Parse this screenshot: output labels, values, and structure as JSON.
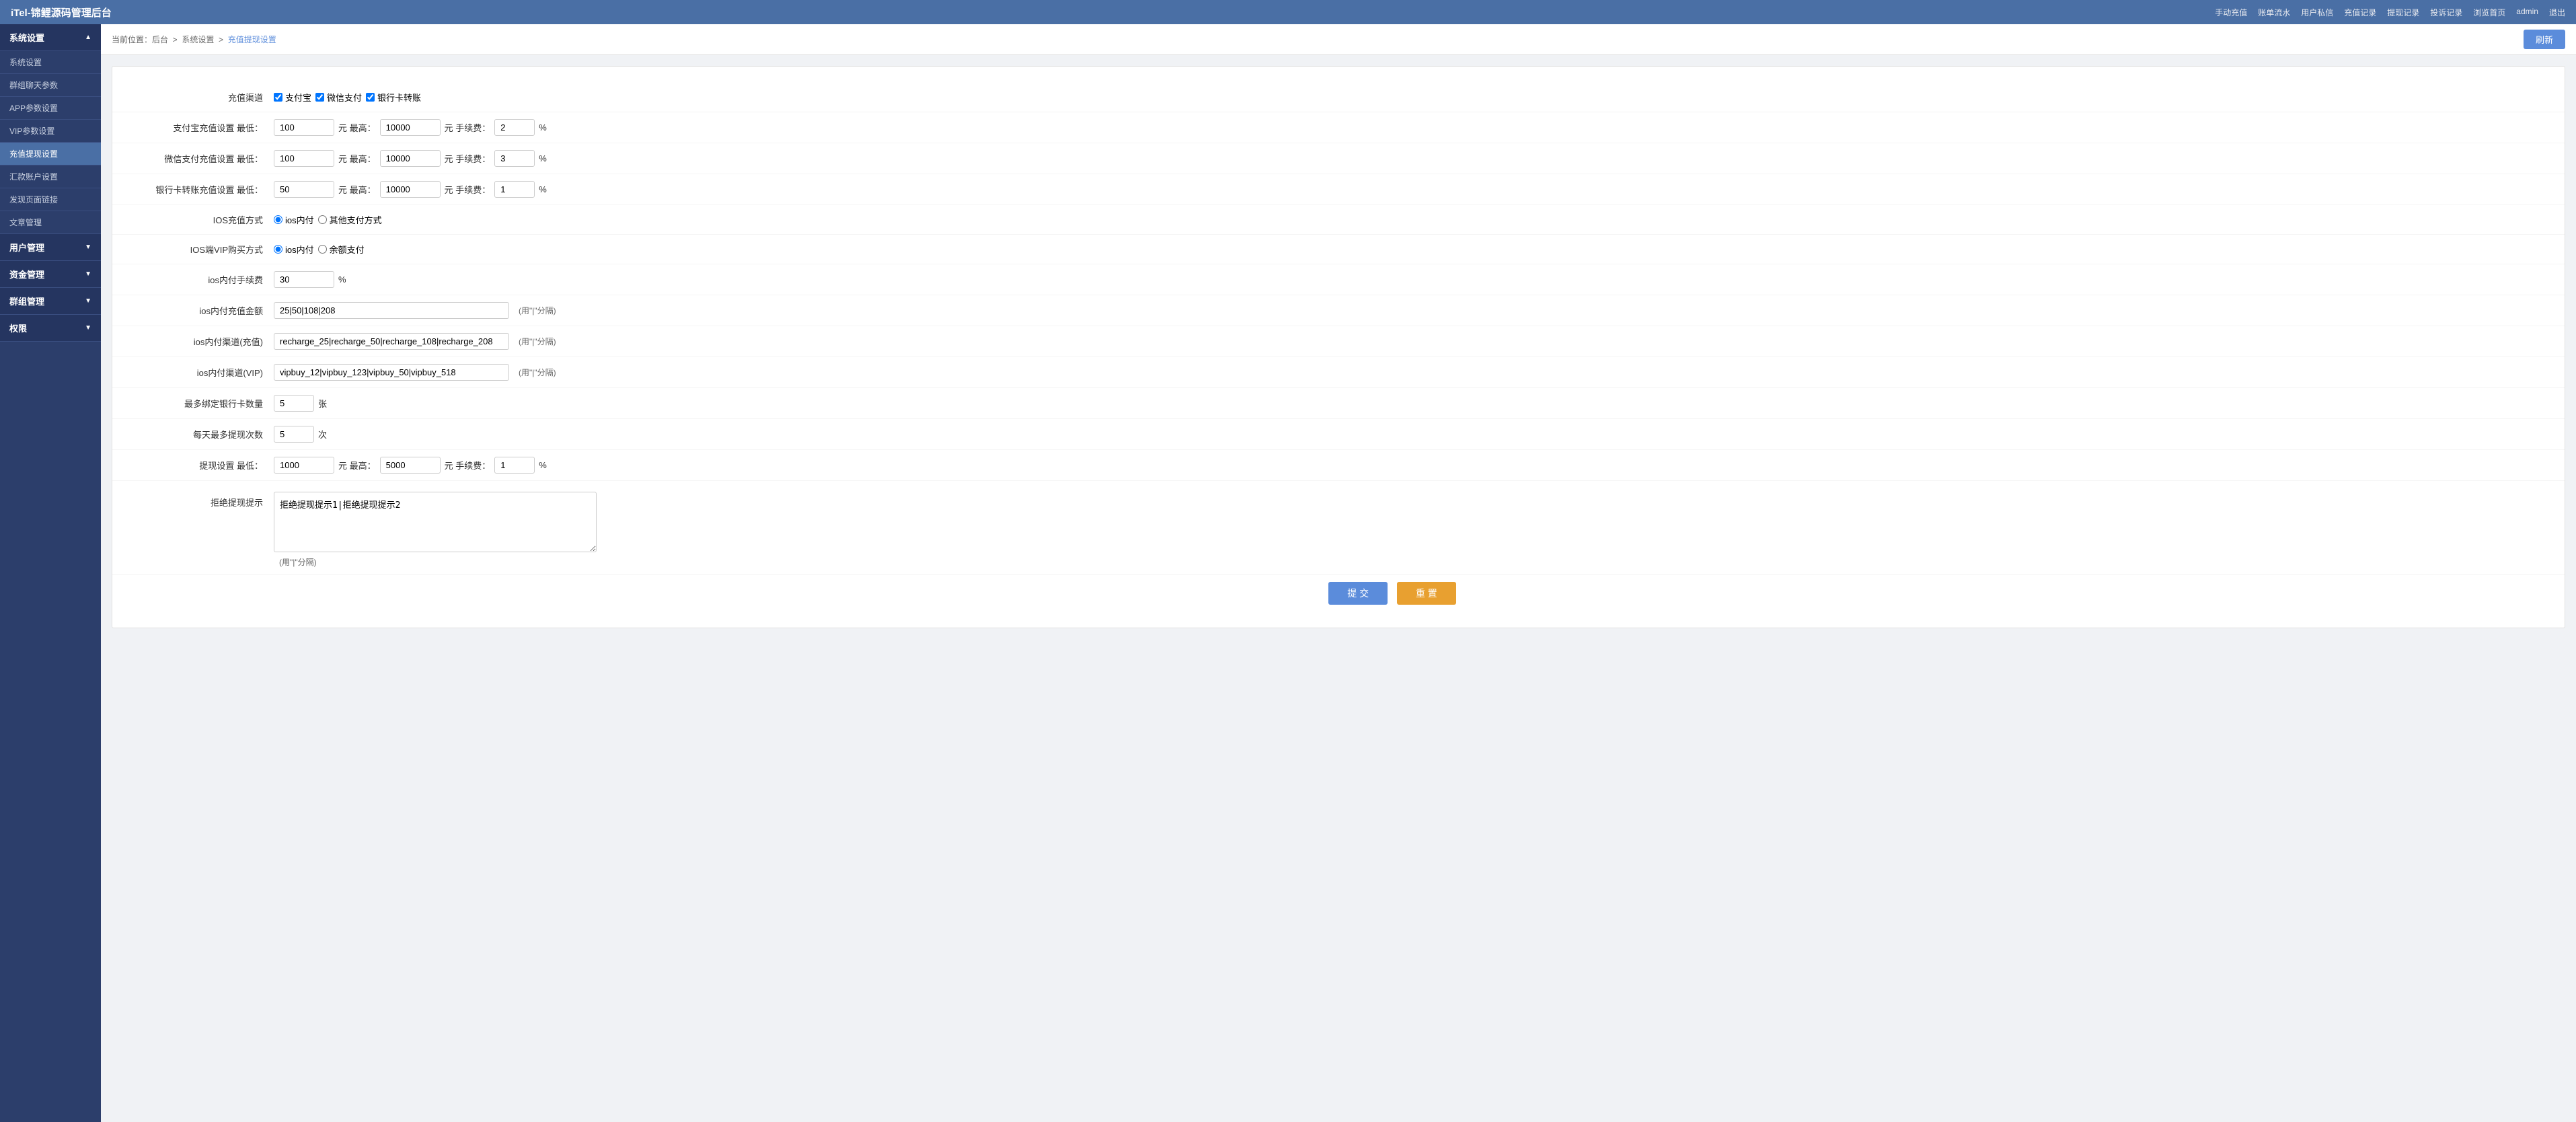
{
  "app": {
    "title": "iTel-锦鲤源码管理后台"
  },
  "topnav": {
    "links": [
      "手动充值",
      "账单流水",
      "用户私信",
      "充值记录",
      "提现记录",
      "投诉记录",
      "浏览首页",
      "admin",
      "退出"
    ]
  },
  "sidebar": {
    "sections": [
      {
        "label": "系统设置",
        "items": [
          {
            "label": "系统设置",
            "active": false
          },
          {
            "label": "群组聊天参数",
            "active": false
          },
          {
            "label": "APP参数设置",
            "active": false
          },
          {
            "label": "VIP参数设置",
            "active": false
          },
          {
            "label": "充值提现设置",
            "active": true
          },
          {
            "label": "汇款账户设置",
            "active": false
          },
          {
            "label": "发现页面链接",
            "active": false
          },
          {
            "label": "文章管理",
            "active": false
          }
        ]
      },
      {
        "label": "用户管理",
        "items": []
      },
      {
        "label": "资金管理",
        "items": []
      },
      {
        "label": "群组管理",
        "items": []
      },
      {
        "label": "权限",
        "items": []
      }
    ]
  },
  "breadcrumb": {
    "text": "当前位置：后台  >  系统设置  >  充值提现设置"
  },
  "refresh_label": "刷新",
  "form": {
    "recharge_channel_label": "充值渠道",
    "alipay_label": "支付宝",
    "wechat_label": "微信支付",
    "bank_label": "银行卡转账",
    "alipay_min_label": "支付宝充值设置 最低：",
    "alipay_min_val": "100",
    "alipay_max_label": "元 最高：",
    "alipay_max_val": "10000",
    "alipay_fee_label": "元 手续费：",
    "alipay_fee_val": "2",
    "alipay_fee_unit": "%",
    "wechat_min_label": "微信支付充值设置 最低：",
    "wechat_min_val": "100",
    "wechat_max_label": "元 最高：",
    "wechat_max_val": "10000",
    "wechat_fee_label": "元 手续费：",
    "wechat_fee_val": "3",
    "wechat_fee_unit": "%",
    "bank_min_label": "银行卡转账充值设置 最低：",
    "bank_min_val": "50",
    "bank_max_label": "元 最高：",
    "bank_max_val": "10000",
    "bank_fee_label": "元 手续费：",
    "bank_fee_val": "1",
    "bank_fee_unit": "%",
    "ios_pay_label": "IOS充值方式",
    "ios_pay_opt1": "ios内付",
    "ios_pay_opt2": "其他支付方式",
    "ios_vip_label": "IOS端VIP购买方式",
    "ios_vip_opt1": "ios内付",
    "ios_vip_opt2": "余额支付",
    "ios_fee_label": "ios内付手续费",
    "ios_fee_val": "30",
    "ios_fee_unit": "%",
    "ios_amount_label": "ios内付充值金额",
    "ios_amount_val": "25|50|108|208",
    "ios_amount_hint": "(用\"|\"分隔)",
    "ios_channel_label": "ios内付渠道(充值)",
    "ios_channel_val": "recharge_25|recharge_50|recharge_108|recharge_208",
    "ios_channel_hint": "(用\"|\"分隔)",
    "ios_vip_channel_label": "ios内付渠道(VIP)",
    "ios_vip_channel_val": "vipbuy_12|vipbuy_123|vipbuy_50|vipbuy_518",
    "ios_vip_channel_hint": "(用\"|\"分隔)",
    "max_bank_cards_label": "最多绑定银行卡数量",
    "max_bank_cards_val": "5",
    "max_bank_cards_unit": "张",
    "daily_withdraw_label": "每天最多提现次数",
    "daily_withdraw_val": "5",
    "daily_withdraw_unit": "次",
    "withdraw_min_label": "提现设置 最低：",
    "withdraw_min_val": "1000",
    "withdraw_max_label": "元 最高：",
    "withdraw_max_val": "5000",
    "withdraw_fee_label": "元 手续费：",
    "withdraw_fee_val": "1",
    "withdraw_fee_unit": "%",
    "reject_label": "拒绝提现提示",
    "reject_val": "拒绝提现提示1|拒绝提现提示2",
    "reject_hint": "(用\"|\"分隔)",
    "submit_label": "提 交",
    "reset_label": "重 置"
  }
}
